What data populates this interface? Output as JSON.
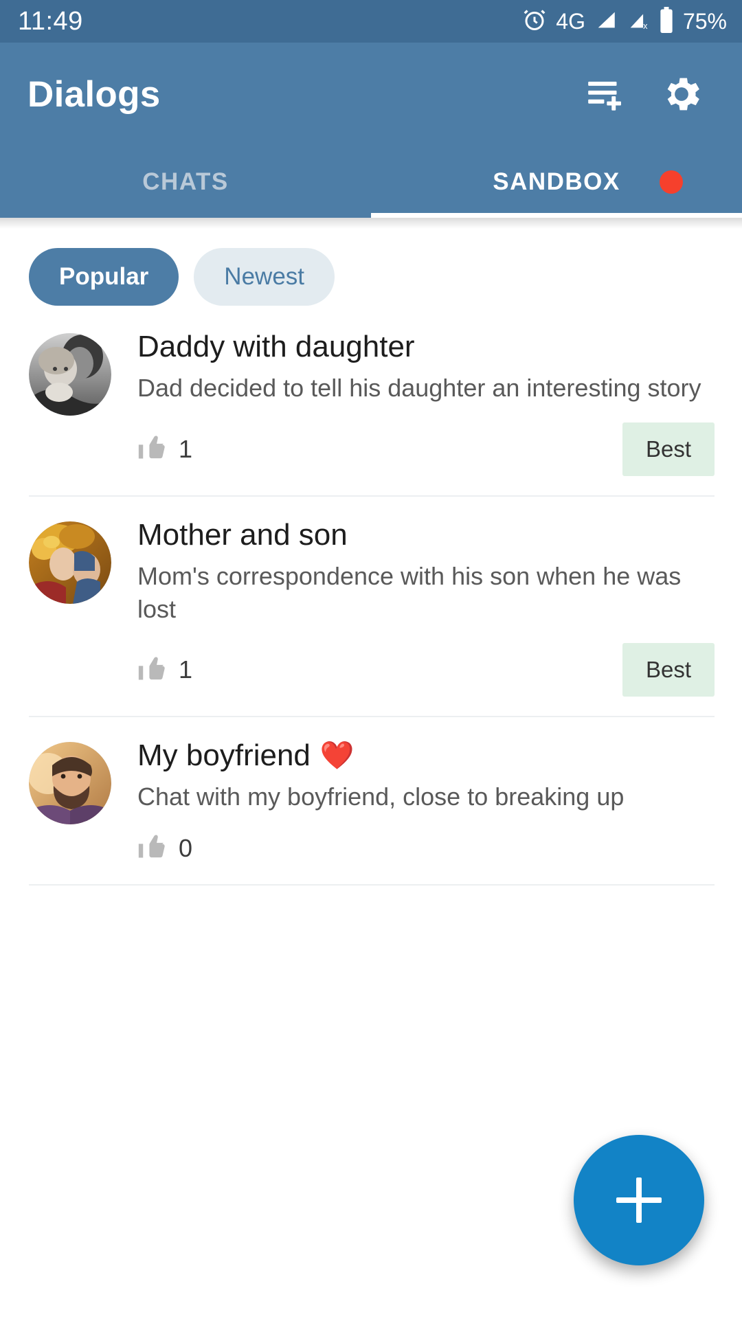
{
  "status_bar": {
    "time": "11:49",
    "network": "4G",
    "battery_percent": "75%",
    "icons": [
      "alarm-icon",
      "signal-full-icon",
      "signal-no-service-icon",
      "battery-icon"
    ]
  },
  "app_bar": {
    "title": "Dialogs",
    "actions": [
      {
        "name": "playlist-add-icon",
        "label": "Add dialog"
      },
      {
        "name": "gear-icon",
        "label": "Settings"
      }
    ]
  },
  "tabs": [
    {
      "label": "CHATS",
      "active": false,
      "badge": false
    },
    {
      "label": "SANDBOX",
      "active": true,
      "badge": true
    }
  ],
  "filters": [
    {
      "label": "Popular",
      "selected": true
    },
    {
      "label": "Newest",
      "selected": false
    }
  ],
  "colors": {
    "status_bar": "#3f6c94",
    "app_bar": "#4d7da6",
    "accent": "#4d7da6",
    "badge_red": "#f6402c",
    "fab": "#1283c6",
    "best_badge_bg": "#dff0e4",
    "chip_unselected_bg": "#e3ebf0",
    "chip_unselected_text": "#4a7ba4"
  },
  "list": [
    {
      "title": "Daddy with daughter",
      "emoji": "",
      "subtitle": "Dad decided to tell his daughter an interesting story",
      "likes": "1",
      "badge": "Best",
      "avatar": "photo-father-and-daughter"
    },
    {
      "title": "Mother and son",
      "emoji": "",
      "subtitle": "Mom's correspondence with his son when he was lost",
      "likes": "1",
      "badge": "Best",
      "avatar": "photo-mother-and-son-autumn"
    },
    {
      "title": "My boyfriend",
      "emoji": "❤️",
      "subtitle": "Chat with my boyfriend, close to breaking up",
      "likes": "0",
      "badge": "",
      "avatar": "photo-bearded-man"
    }
  ],
  "fab": {
    "label": "+",
    "name": "add-dialog-fab"
  }
}
